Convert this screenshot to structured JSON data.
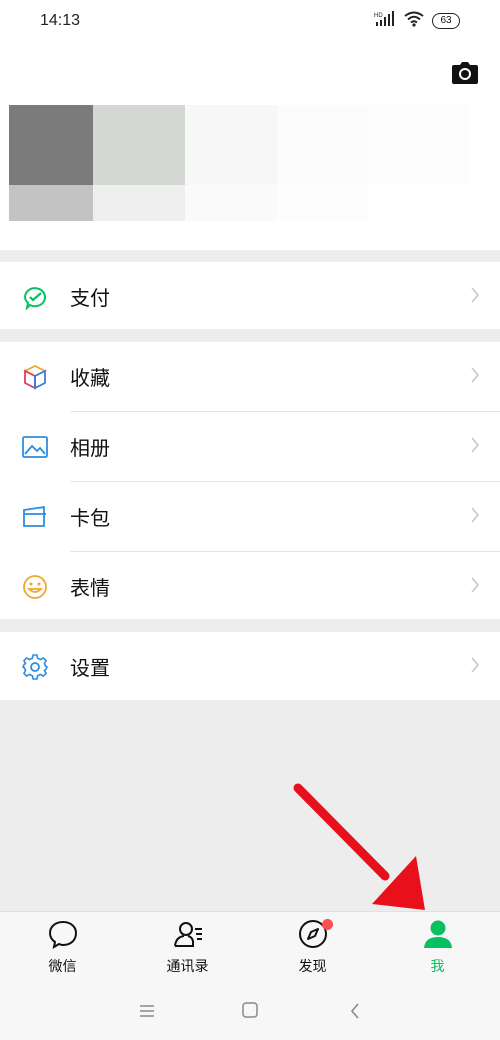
{
  "status": {
    "time": "14:13",
    "battery": "63",
    "network": "HD"
  },
  "header": {
    "camera_icon": "camera-icon"
  },
  "menu": {
    "pay": {
      "label": "支付",
      "icon": "wallet-icon"
    },
    "favorites": {
      "label": "收藏",
      "icon": "cube-icon"
    },
    "album": {
      "label": "相册",
      "icon": "image-icon"
    },
    "cards": {
      "label": "卡包",
      "icon": "card-icon"
    },
    "stickers": {
      "label": "表情",
      "icon": "smiley-icon"
    },
    "settings": {
      "label": "设置",
      "icon": "gear-icon"
    }
  },
  "tabs": [
    {
      "label": "微信",
      "icon": "chat-bubble-icon",
      "active": false
    },
    {
      "label": "通讯录",
      "icon": "contacts-icon",
      "active": false
    },
    {
      "label": "发现",
      "icon": "compass-icon",
      "active": false,
      "badge": true
    },
    {
      "label": "我",
      "icon": "person-icon",
      "active": true
    }
  ],
  "colors": {
    "accent": "#07c160",
    "badge": "#fa5151",
    "arrow": "#e8101a"
  }
}
